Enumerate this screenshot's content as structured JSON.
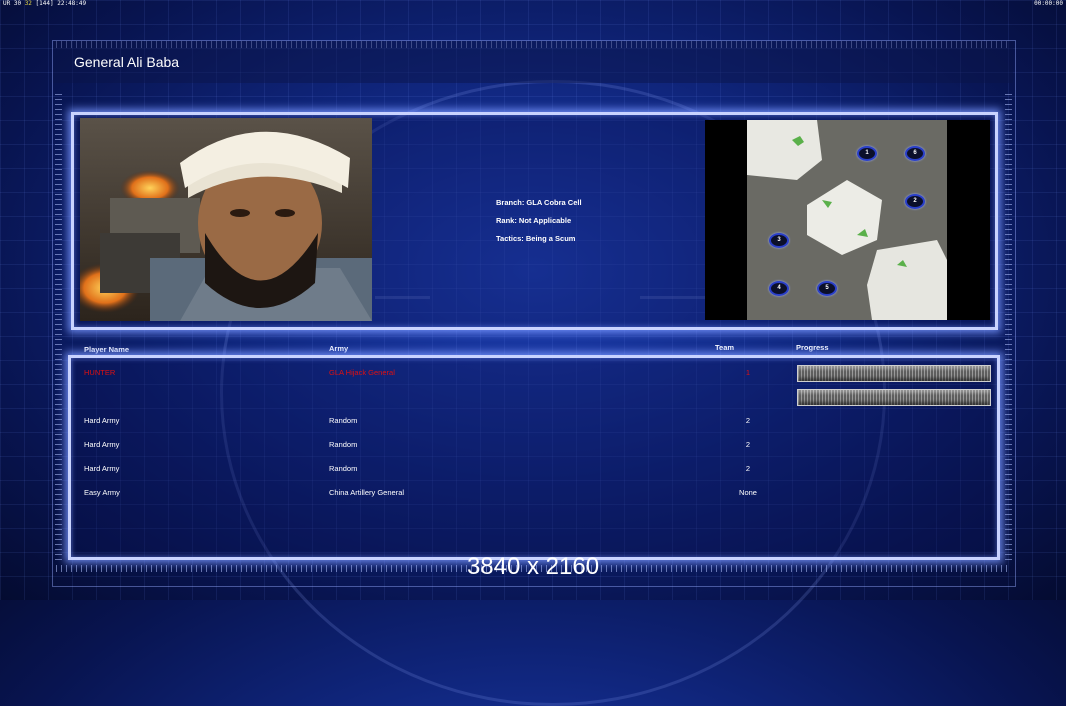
{
  "hud": {
    "stats_left": "UR 30",
    "stats_fps": "32",
    "stats_mid": "[144]",
    "clock_left": "22:48:49",
    "clock_right": "00:00:00"
  },
  "general": {
    "name": "General Ali Baba",
    "branch": "Branch: GLA Cobra Cell",
    "rank": "Rank: Not Applicable",
    "tactics": "Tactics: Being a Scum"
  },
  "map": {
    "spawns": [
      "1",
      "6",
      "2",
      "3",
      "4",
      "5"
    ]
  },
  "table": {
    "headers": {
      "player_name": "Player Name",
      "army": "Army",
      "team": "Team",
      "progress": "Progress"
    },
    "rows": [
      {
        "player": "HUNTER",
        "army": "GLA Hijack General",
        "team": "1",
        "color": "#e01010",
        "has_progress": true
      },
      {
        "player": "",
        "army": "",
        "team": "",
        "color": "#1533d6",
        "has_progress": true
      },
      {
        "player": "Hard Army",
        "army": "Random",
        "team": "2",
        "color": "#ffffff",
        "has_progress": false
      },
      {
        "player": "Hard Army",
        "army": "Random",
        "team": "2",
        "color": "#ffffff",
        "has_progress": false
      },
      {
        "player": "Hard Army",
        "army": "Random",
        "team": "2",
        "color": "#ffffff",
        "has_progress": false
      },
      {
        "player": "Easy Army",
        "army": "China Artillery General",
        "team": "None",
        "color": "#ffffff",
        "has_progress": false
      }
    ]
  },
  "resolution_label": "3840 x 2160",
  "colors": {
    "panel_glow": "#c9d3ff",
    "background": "#0f2479",
    "player_red": "#e01010",
    "player_blue": "#1533d6"
  }
}
